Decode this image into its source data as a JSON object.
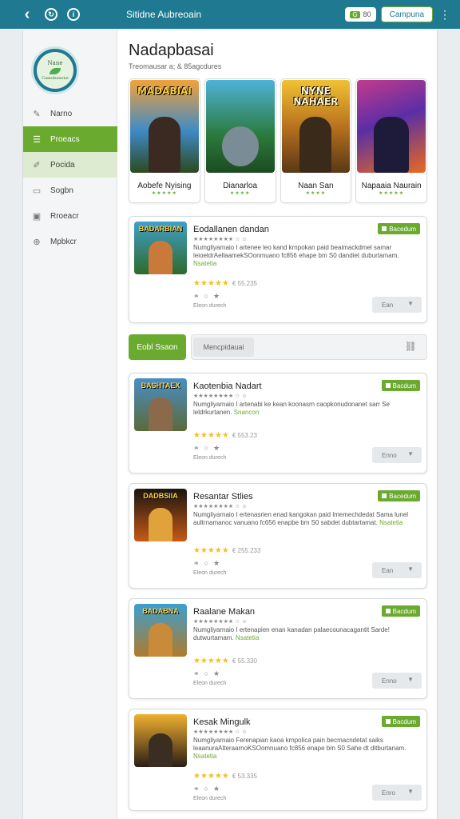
{
  "topbar": {
    "title": "Sitidne Aubreoain",
    "badge_icon": "G",
    "badge_text": "80",
    "button": "Campuna",
    "icons": [
      "back-arrow-icon",
      "refresh-icon",
      "info-icon",
      "more-vert-icon"
    ]
  },
  "logo": {
    "line1": "Nane",
    "line2": "Camubanone"
  },
  "sidebar": {
    "items": [
      {
        "label": "Narno",
        "icon": "pencil-icon",
        "state": "normal"
      },
      {
        "label": "Proeacs",
        "icon": "list-icon",
        "state": "active"
      },
      {
        "label": "Pocida",
        "icon": "brush-icon",
        "state": "soft"
      },
      {
        "label": "Sogbn",
        "icon": "document-icon",
        "state": "normal"
      },
      {
        "label": "Rroeacr",
        "icon": "image-icon",
        "state": "normal"
      },
      {
        "label": "Mpbkcr",
        "icon": "globe-icon",
        "state": "normal"
      }
    ]
  },
  "main": {
    "title": "Nadapbasai",
    "subtitle": "Treomausar a; & 85agcdures"
  },
  "featured": [
    {
      "art_title": "MADABIAI",
      "name": "Aobefe Nyising",
      "stars": "★★★★★"
    },
    {
      "art_title": "",
      "name": "Dianarloa",
      "stars": "★★★★"
    },
    {
      "art_title": "NYNE NAHAER",
      "name": "Naan San",
      "stars": "★★★★"
    },
    {
      "art_title": "",
      "name": "Napaaia Naurain",
      "stars": "★★★★★"
    }
  ],
  "filter": {
    "button": "Eobl Ssaon",
    "chip": "Mencpidauai",
    "link_icon": "link-icon"
  },
  "cards": [
    {
      "thumb_title": "BADARBIAN",
      "title": "Eodallanen dandan",
      "badge": "Bacedum",
      "meta": "★★★★★★★★ ☆ ☺",
      "desc": "Numgliyarnaio I artenee leo kand krnpokan paid beaimackdmel samar leioeldrAellaamekSOonmuano fc856 ehape bm S0 dandiet duburtamam.",
      "desc_hl": "Nsatetia",
      "rating": "★★★★★",
      "count": "€ 55.235",
      "downloads": "Eleon durech",
      "button": "Ean"
    },
    {
      "thumb_title": "BASHTAEX",
      "title": "Kaotenbia Nadart",
      "badge": "Bacdum",
      "meta": "★★★★★★★★ ☆ ☺",
      "desc": "Numgliyarnaio I artenabi ke kean koonasrn caopkonudonanet sarr Se leldrkurtanen.",
      "desc_hl": "Snancon",
      "rating": "★★★★★",
      "count": "€ 553.23",
      "downloads": "Eleon durech",
      "button": "Enno"
    },
    {
      "thumb_title": "DADBSIIA",
      "title": "Resantar Stlies",
      "badge": "Bacedum",
      "meta": "★★★★★★★★ ☆ ☺",
      "desc": "Numgliyarnaio I ertenasrien enad kangokan paid lmemechdedat Sama lunel aultrnamanoc vanuano fc656 enapbe bm S0 sabdet dubtartamat.",
      "desc_hl": "Nsatetia",
      "rating": "★★★★★",
      "count": "€ 255.233",
      "downloads": "Eleon durech",
      "button": "Ean"
    },
    {
      "thumb_title": "BADABNA",
      "title": "Raalane Makan",
      "badge": "Bacdum",
      "meta": "★★★★★★★★ ☆ ☺",
      "desc": "Numgliyarnaio I ertenapien enan kanadan palaecounacagantit Sarde! dutwurtamam.",
      "desc_hl": "Nsatetia",
      "rating": "★★★★★",
      "count": "€ 55.330",
      "downloads": "Eleon durech",
      "button": "Enno"
    },
    {
      "thumb_title": "",
      "title": "Kesak Mingulk",
      "badge": "Bacdum",
      "meta": "★★★★★★★★ ☆ ☺",
      "desc": "Numgliyarnaio Ferenapian kaoa krnpolica pain becmacndetat saiks leaanuraAlteraarnoKSOomnuano fc856 enape bm S0 Sahe dt ditburtanam.",
      "desc_hl": "Nsatetia",
      "rating": "★★★★★",
      "count": "€ 53.335",
      "downloads": "Eleon durech",
      "button": "Enro"
    }
  ],
  "colors": {
    "topbar": "#1f7a91",
    "accent": "#6aaa2e",
    "star": "#f3c11e"
  }
}
